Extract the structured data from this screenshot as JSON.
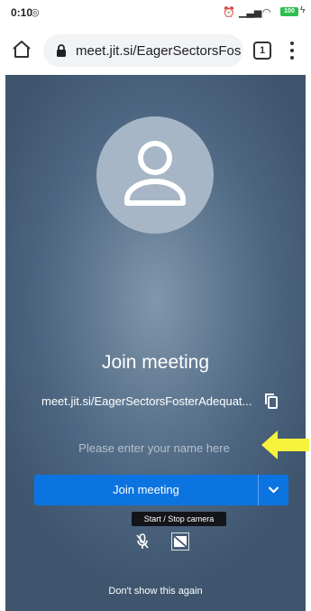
{
  "status_bar": {
    "time": "0:10",
    "battery": "100"
  },
  "browser": {
    "url": "meet.jit.si/EagerSectorsFos",
    "tab_count": "1"
  },
  "meeting": {
    "title": "Join meeting",
    "meeting_url": "meet.jit.si/EagerSectorsFosterAdequat...",
    "name_placeholder": "Please enter your name here",
    "name_value": "",
    "join_label": "Join meeting",
    "tooltip": "Start / Stop camera",
    "dont_show_label": "Don't show this again"
  },
  "colors": {
    "join_button": "#0c74e0",
    "annotation_arrow": "#f7f23c"
  },
  "icons": [
    "home-icon",
    "lock-icon",
    "tabs-icon",
    "more-vert-icon",
    "avatar-icon",
    "copy-icon",
    "chevron-down-icon",
    "mic-off-icon",
    "camera-off-icon",
    "annotation-arrow-icon"
  ]
}
